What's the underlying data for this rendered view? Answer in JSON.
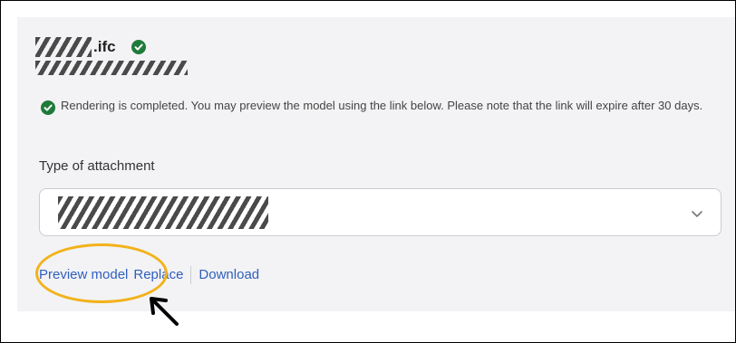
{
  "file": {
    "extension": ".ifc",
    "status_icon": "check-circle-icon"
  },
  "notice": {
    "icon": "check-circle-icon",
    "text": "Rendering is completed. You may preview the model using the link below. Please note that the link will expire after 30 days."
  },
  "attachment": {
    "label": "Type of attachment",
    "chevron_icon": "chevron-down-icon"
  },
  "actions": {
    "preview_label": "Preview model",
    "replace_label": "Replace",
    "download_label": "Download"
  },
  "annotation": {
    "highlight_color": "#f2b21a",
    "pointer": "arrow-icon"
  },
  "colors": {
    "accent": "#2f5fbf",
    "success": "#1f7a3a"
  }
}
